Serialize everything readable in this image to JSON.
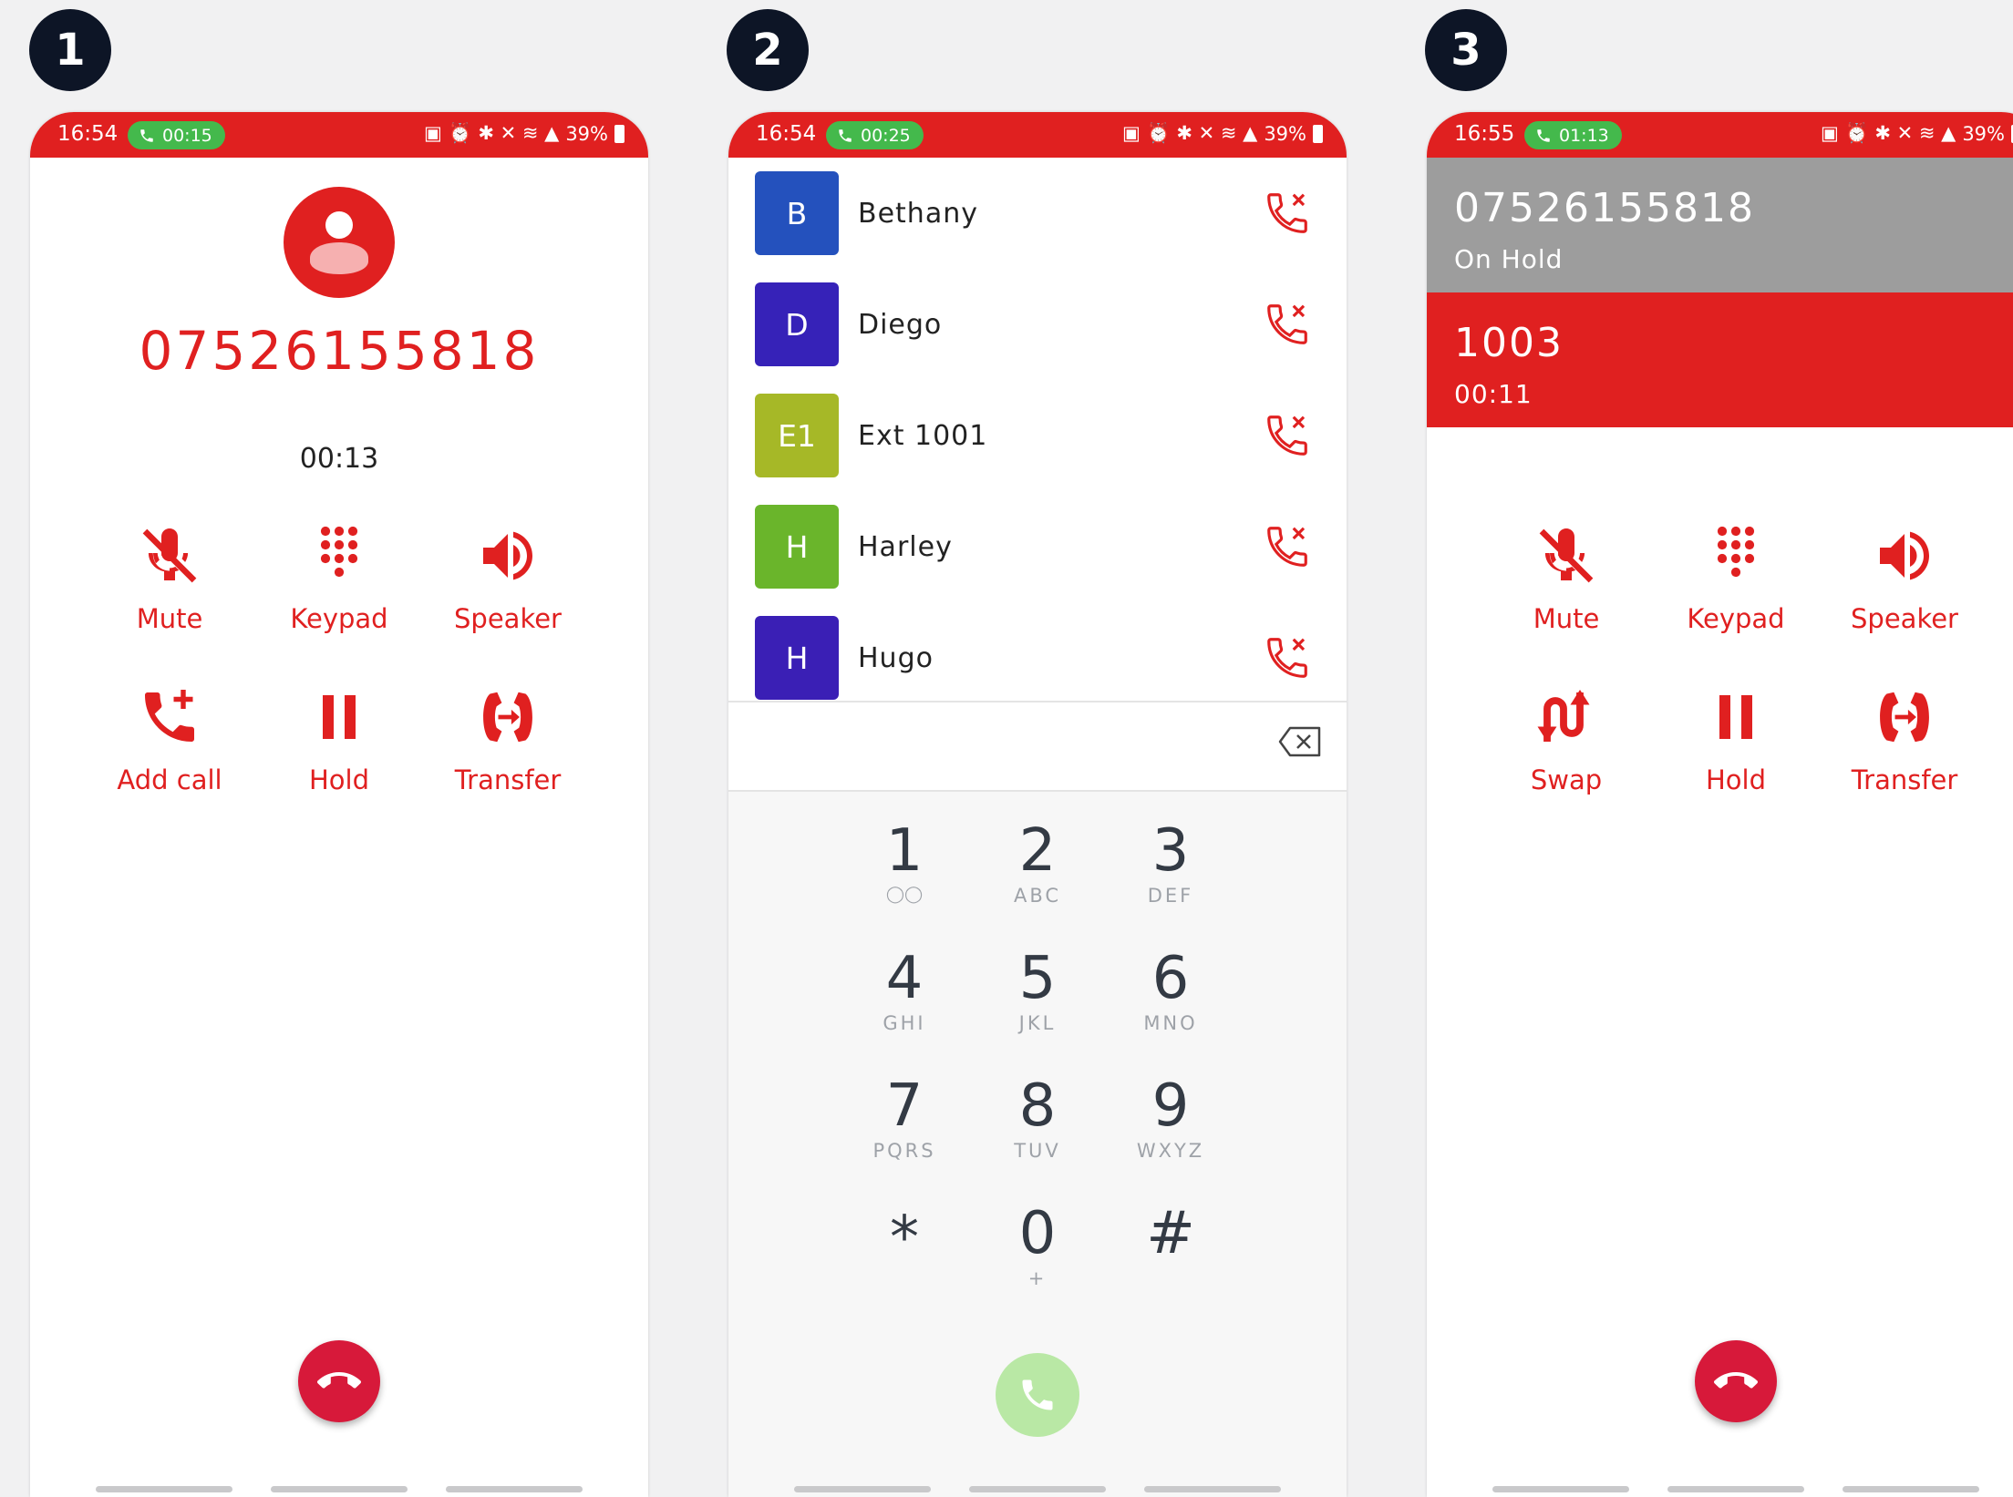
{
  "badges": [
    "1",
    "2",
    "3"
  ],
  "colors": {
    "accent": "#e02020",
    "call_pill": "#44b94c",
    "hangup": "#d7193a",
    "held_bg": "#9d9d9d",
    "badge_bg": "#0d1526"
  },
  "phone1": {
    "status": {
      "time": "16:54",
      "call_duration": "00:15",
      "battery": "39%"
    },
    "number": "07526155818",
    "timer": "00:13",
    "controls": {
      "mute": "Mute",
      "keypad": "Keypad",
      "speaker": "Speaker",
      "add_call": "Add call",
      "hold": "Hold",
      "transfer": "Transfer"
    }
  },
  "phone2": {
    "status": {
      "time": "16:54",
      "call_duration": "00:25",
      "battery": "39%"
    },
    "contacts": [
      {
        "initial": "B",
        "name": "Bethany",
        "color": "#2451bd"
      },
      {
        "initial": "D",
        "name": "Diego",
        "color": "#3622b8"
      },
      {
        "initial": "E1",
        "name": "Ext 1001",
        "color": "#a6b827"
      },
      {
        "initial": "H",
        "name": "Harley",
        "color": "#6ab52b"
      },
      {
        "initial": "H",
        "name": "Hugo",
        "color": "#3a1fb5"
      }
    ],
    "keys": [
      {
        "digit": "1",
        "letters": ""
      },
      {
        "digit": "2",
        "letters": "ABC"
      },
      {
        "digit": "3",
        "letters": "DEF"
      },
      {
        "digit": "4",
        "letters": "GHI"
      },
      {
        "digit": "5",
        "letters": "JKL"
      },
      {
        "digit": "6",
        "letters": "MNO"
      },
      {
        "digit": "7",
        "letters": "PQRS"
      },
      {
        "digit": "8",
        "letters": "TUV"
      },
      {
        "digit": "9",
        "letters": "WXYZ"
      },
      {
        "digit": "*",
        "letters": ""
      },
      {
        "digit": "0",
        "letters": "+"
      },
      {
        "digit": "#",
        "letters": ""
      }
    ]
  },
  "phone3": {
    "status": {
      "time": "16:55",
      "call_duration": "01:13",
      "battery": "39%"
    },
    "held_call": {
      "number": "07526155818",
      "status": "On Hold"
    },
    "active_call": {
      "number": "1003",
      "timer": "00:11"
    },
    "controls": {
      "mute": "Mute",
      "keypad": "Keypad",
      "speaker": "Speaker",
      "swap": "Swap",
      "hold": "Hold",
      "transfer": "Transfer"
    }
  }
}
